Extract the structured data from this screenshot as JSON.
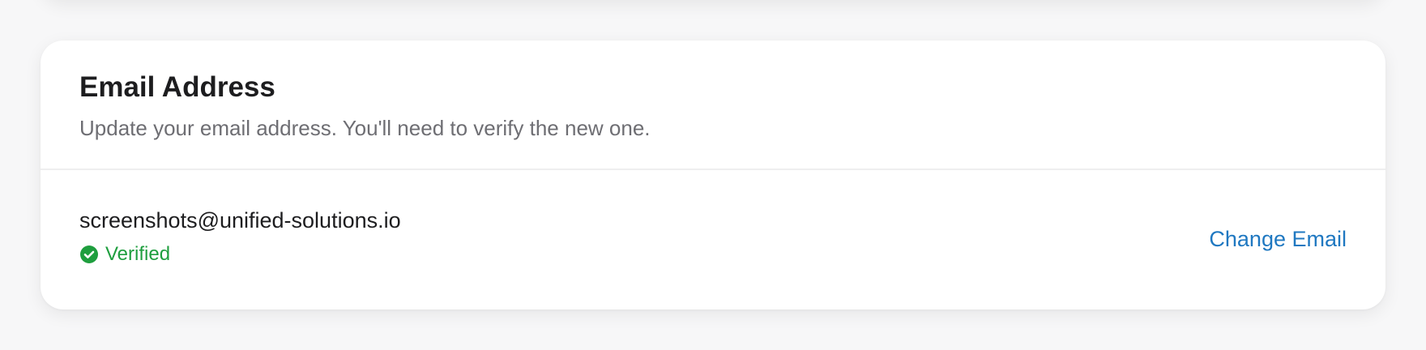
{
  "email_section": {
    "title": "Email Address",
    "subtitle": "Update your email address. You'll need to verify the new one.",
    "current_email": "screenshots@unified-solutions.io",
    "status_label": "Verified",
    "status_icon": "check-circle-icon",
    "change_button_label": "Change Email"
  },
  "colors": {
    "verified": "#1e9e3e",
    "link": "#1f78c1",
    "title": "#1d1d1f",
    "subtitle": "#6e6e73"
  }
}
